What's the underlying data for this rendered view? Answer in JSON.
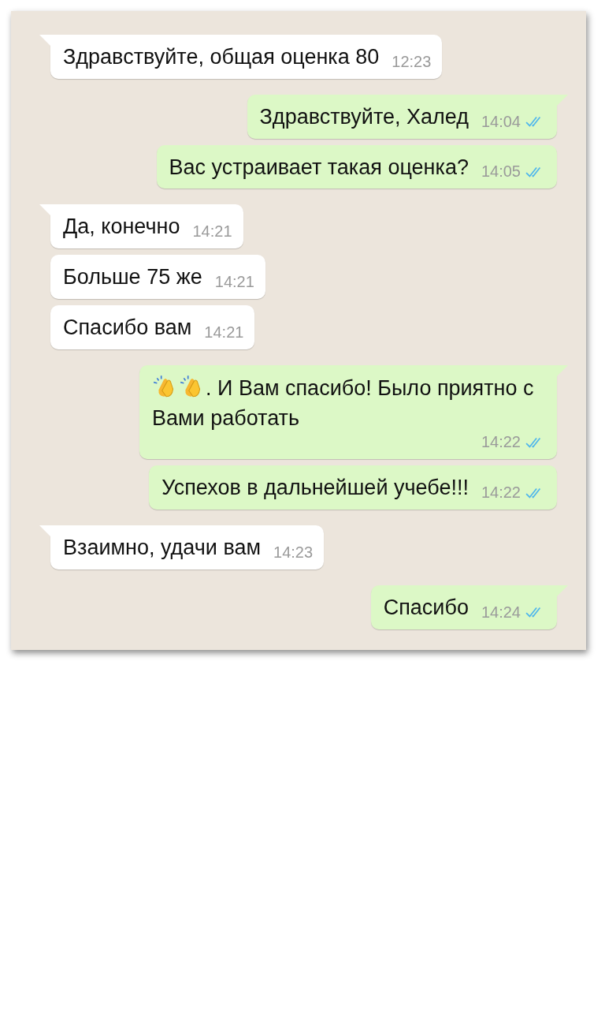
{
  "messages": [
    {
      "kind": "text",
      "outgoing": false,
      "text": "Здравствуйте, общая оценка 80",
      "time": "12:23"
    },
    {
      "kind": "text",
      "outgoing": true,
      "text": "Здравствуйте, Халед",
      "time": "14:04",
      "read": true
    },
    {
      "kind": "text",
      "outgoing": true,
      "text": "Вас устраивает такая оценка?",
      "time": "14:05",
      "read": true
    },
    {
      "kind": "text",
      "outgoing": false,
      "text": "Да, конечно",
      "time": "14:21"
    },
    {
      "kind": "text",
      "outgoing": false,
      "text": "Больше 75 же",
      "time": "14:21"
    },
    {
      "kind": "text",
      "outgoing": false,
      "text": "Спасибо вам",
      "time": "14:21"
    },
    {
      "kind": "clap_emoji",
      "outgoing": true,
      "text": ". И Вам спасибо! Было приятно с Вами работать",
      "time": "14:22",
      "read": true
    },
    {
      "kind": "text",
      "outgoing": true,
      "text": "Успехов в дальнейшей учебе!!!",
      "time": "14:22",
      "read": true
    },
    {
      "kind": "text",
      "outgoing": false,
      "text": "Взаимно, удачи вам",
      "time": "14:23"
    },
    {
      "kind": "text",
      "outgoing": true,
      "text": "Спасибо",
      "time": "14:24",
      "read": true
    }
  ]
}
